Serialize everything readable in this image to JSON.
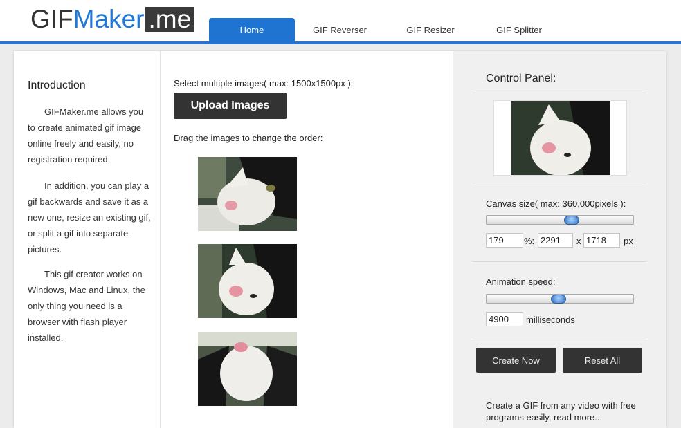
{
  "logo": {
    "part1": "GIF",
    "part2": "Maker",
    "part3": ".me"
  },
  "nav": [
    {
      "label": "Home",
      "active": true
    },
    {
      "label": "GIF Reverser"
    },
    {
      "label": "GIF Resizer"
    },
    {
      "label": "GIF Splitter"
    }
  ],
  "intro": {
    "title": "Introduction",
    "paragraphs": [
      "GIFMaker.me allows you to create animated gif image online freely and easily, no registration required.",
      "In addition, you can play a gif backwards and save it as a new one, resize an existing gif, or split a gif into separate pictures.",
      "This gif creator works on Windows, Mac and Linux, the only thing you need is a browser with flash player installed."
    ]
  },
  "main": {
    "select_label": "Select multiple images( max: 1500x1500px ):",
    "upload_label": "Upload Images",
    "drag_label": "Drag the images to change the order:"
  },
  "control": {
    "title": "Control Panel:",
    "canvas_label": "Canvas size( max: 360,000pixels ):",
    "canvas_percent": "179",
    "percent_sep": "%:",
    "canvas_width": "2291",
    "times": "x",
    "canvas_height": "1718",
    "px": "px",
    "speed_label": "Animation speed:",
    "speed_value": "4900",
    "speed_unit": "milliseconds",
    "canvas_slider_level": 0.58,
    "speed_slider_level": 0.49,
    "create_label": "Create Now",
    "reset_label": "Reset All",
    "promo": "Create a GIF from any video with free programs easily, read more..."
  },
  "colors": {
    "brand_blue": "#1f73d1",
    "dark": "#333333"
  },
  "images": [
    "cat-photo-1",
    "cat-photo-2",
    "cat-photo-3"
  ]
}
